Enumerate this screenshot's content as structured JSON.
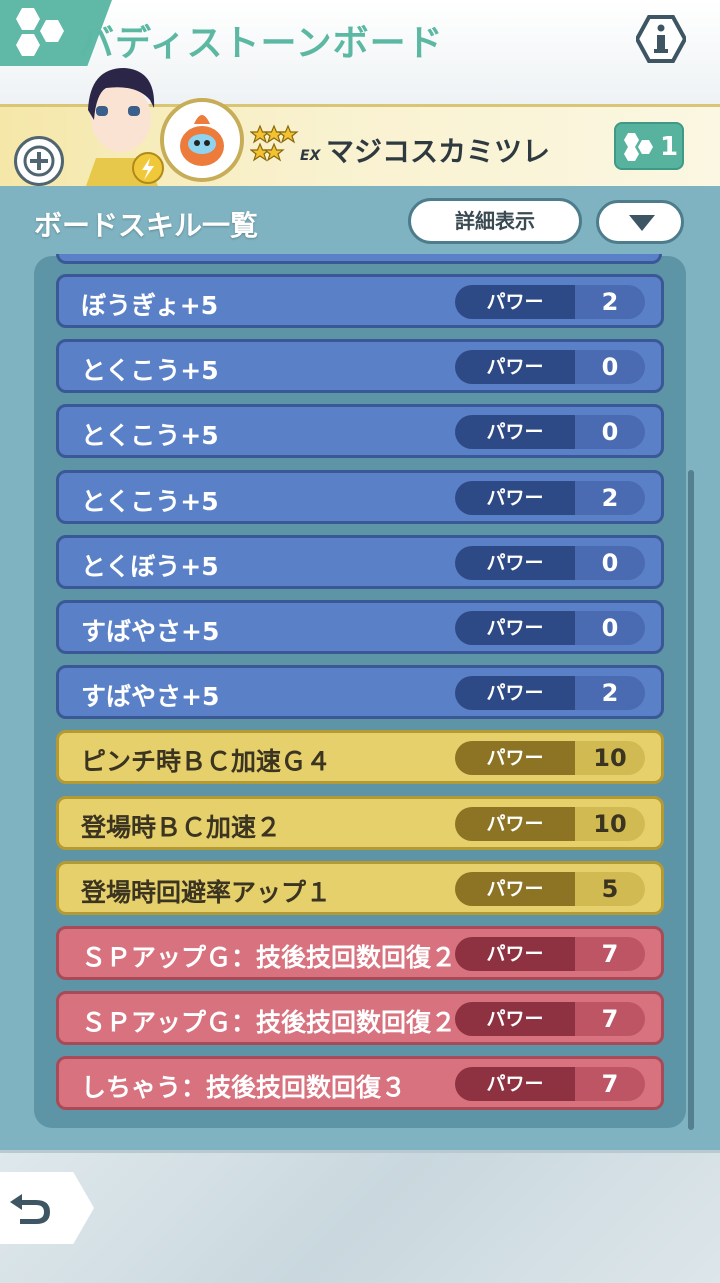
{
  "header": {
    "title": "バディストーンボード"
  },
  "partner": {
    "pokemon_name": "マジコスカミツレ",
    "stone_count": "1",
    "rank_label": "EX"
  },
  "section": {
    "title": "ボードスキル一覧",
    "detail_button": "詳細表示"
  },
  "skills": [
    {
      "name": "ぼうぎょ+5",
      "label": "パワー",
      "value": "2",
      "kind": "blue"
    },
    {
      "name": "とくこう+5",
      "label": "パワー",
      "value": "0",
      "kind": "blue"
    },
    {
      "name": "とくこう+5",
      "label": "パワー",
      "value": "0",
      "kind": "blue"
    },
    {
      "name": "とくこう+5",
      "label": "パワー",
      "value": "2",
      "kind": "blue"
    },
    {
      "name": "とくぼう+5",
      "label": "パワー",
      "value": "0",
      "kind": "blue"
    },
    {
      "name": "すばやさ+5",
      "label": "パワー",
      "value": "0",
      "kind": "blue"
    },
    {
      "name": "すばやさ+5",
      "label": "パワー",
      "value": "2",
      "kind": "blue"
    },
    {
      "name": "ピンチ時ＢＣ加速Ｇ４",
      "label": "パワー",
      "value": "10",
      "kind": "yellow"
    },
    {
      "name": "登場時ＢＣ加速２",
      "label": "パワー",
      "value": "10",
      "kind": "yellow"
    },
    {
      "name": "登場時回避率アップ１",
      "label": "パワー",
      "value": "5",
      "kind": "yellow"
    },
    {
      "name": "ＳＰアップＧ：技後技回数回復２",
      "label": "パワー",
      "value": "7",
      "kind": "red"
    },
    {
      "name": "ＳＰアップＧ：技後技回数回復２",
      "label": "パワー",
      "value": "7",
      "kind": "red"
    },
    {
      "name": "しちゃう：技後技回数回復３",
      "label": "パワー",
      "value": "7",
      "kind": "red"
    }
  ],
  "colors": {
    "accent": "#5cb8a2",
    "blue_row": "#5a80c8",
    "yellow_row": "#e6d06c",
    "red_row": "#d8727e"
  }
}
